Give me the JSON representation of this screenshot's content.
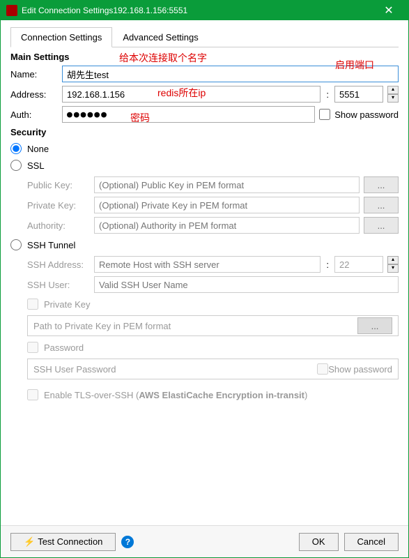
{
  "window": {
    "title": "Edit Connection Settings192.168.1.156:5551"
  },
  "tabs": {
    "connection": "Connection Settings",
    "advanced": "Advanced Settings"
  },
  "main": {
    "heading": "Main Settings",
    "name_label": "Name:",
    "name_value": "胡先生test",
    "address_label": "Address:",
    "address_value": "192.168.1.156",
    "port_value": "5551",
    "auth_label": "Auth:",
    "auth_mask": "●●●●●●",
    "show_password": "Show password"
  },
  "security": {
    "heading": "Security",
    "none": "None",
    "ssl": "SSL",
    "ssl_public_label": "Public Key:",
    "ssl_public_ph": "(Optional) Public Key in PEM format",
    "ssl_private_label": "Private Key:",
    "ssl_private_ph": "(Optional) Private Key in PEM format",
    "ssl_authority_label": "Authority:",
    "ssl_authority_ph": "(Optional) Authority in PEM format",
    "browse": "...",
    "ssh": "SSH Tunnel",
    "ssh_addr_label": "SSH Address:",
    "ssh_addr_ph": "Remote Host with SSH server",
    "ssh_port_value": "22",
    "ssh_user_label": "SSH User:",
    "ssh_user_ph": "Valid SSH User Name",
    "ssh_private_key": "Private Key",
    "ssh_pk_path_ph": "Path to Private Key in PEM format",
    "ssh_password": "Password",
    "ssh_pwd_ph": "SSH User Password",
    "ssh_show_password": "Show password",
    "tls_over_ssh_pre": "Enable TLS-over-SSH (",
    "tls_over_ssh_bold": "AWS ElastiCache Encryption in-transit",
    "tls_over_ssh_post": ")"
  },
  "footer": {
    "test": "Test Connection",
    "ok": "OK",
    "cancel": "Cancel"
  },
  "annotations": {
    "name_hint": "给本次连接取个名字",
    "port_hint": "启用端口",
    "addr_hint": "redis所在ip",
    "pwd_hint": "密码"
  }
}
